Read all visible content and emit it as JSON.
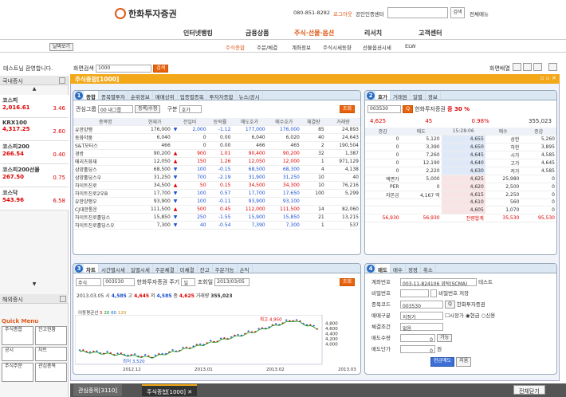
{
  "header": {
    "brand": "한화투자증권",
    "phone": "080-851-8282",
    "login": "로그아웃",
    "cert": "공인인증센터",
    "search_btn": "검색",
    "all_menu": "전체메뉴"
  },
  "nav": [
    "인터넷뱅킹",
    "금융상품",
    "주식·선물·옵션",
    "리서치",
    "고객센터"
  ],
  "subnav": [
    "주식종합",
    "주문/체결",
    "계좌정보",
    "주식시세동향",
    "선물옵션시세",
    "ELW"
  ],
  "datefilter": "날짜보기",
  "welcome": "테스트님 환영합니다.",
  "screen_search": {
    "label": "화면검색",
    "value": "1000",
    "button": "검색",
    "layout_label": "화면배열"
  },
  "left": {
    "domestic_title": "국내증시",
    "indices": [
      {
        "name": "코스피",
        "value": "2,016.61",
        "change": "3.46"
      },
      {
        "name": "KRX100",
        "value": "4,317.25",
        "change": "2.60"
      },
      {
        "name": "코스피200",
        "value": "266.54",
        "change": "0.40"
      },
      {
        "name": "코스피200선물",
        "value": "267.50",
        "change": "0.75"
      },
      {
        "name": "코스닥",
        "value": "543.96",
        "change": "6.58"
      }
    ],
    "overseas_title": "해외증시",
    "quick_title": "Quick Menu",
    "quick": [
      "주식종합",
      "잔고현황",
      "공시",
      "차트",
      "주식주문",
      "관심종목"
    ]
  },
  "main_title": "주식종합[1000]",
  "p1": {
    "tabs": [
      "종합",
      "종목별투자",
      "순위정보",
      "매매상위",
      "업종별종목",
      "투자자종합",
      "뉴스/공시"
    ],
    "group_label": "관심그룹",
    "group_value": "00 내그룹",
    "reg_btn": "등록/수정",
    "div_label": "구분",
    "div_value": "호가",
    "query": "조회",
    "cols": [
      "종목명",
      "현재가",
      "전일비",
      "등락률",
      "매도호가",
      "매수호가",
      "체결량",
      "거래량"
    ],
    "rows": [
      [
        "유한양행",
        "176,000",
        "▼",
        "2,000",
        "-1.12",
        "177,000",
        "176,000",
        "85",
        "24,893"
      ],
      [
        "동화약품",
        "6,040",
        "",
        "0",
        "0.00",
        "6,040",
        "6,020",
        "40",
        "24,643"
      ],
      [
        "S&T모터스",
        "466",
        "",
        "0",
        "0.00",
        "466",
        "465",
        "2",
        "190,504"
      ],
      [
        "경방",
        "90,200",
        "▲",
        "900",
        "1.01",
        "90,400",
        "90,200",
        "32",
        "1,387"
      ],
      [
        "메리츠화재",
        "12,050",
        "▲",
        "150",
        "1.26",
        "12,050",
        "12,000",
        "1",
        "971,129"
      ],
      [
        "삼양홀딩스",
        "68,500",
        "▼",
        "100",
        "-0.15",
        "68,500",
        "68,300",
        "4",
        "4,138"
      ],
      [
        "삼양홀딩스우",
        "31,250",
        "▼",
        "700",
        "-2.19",
        "31,900",
        "31,250",
        "10",
        "40"
      ],
      [
        "하이트진로",
        "34,500",
        "▲",
        "50",
        "0.15",
        "34,500",
        "34,300",
        "10",
        "76,216"
      ],
      [
        "하이트진로2우B",
        "17,700",
        "▼",
        "100",
        "0.57",
        "17,700",
        "17,650",
        "100",
        "5,299"
      ],
      [
        "유한양행우",
        "93,900",
        "▼",
        "100",
        "-0.11",
        "93,900",
        "93,100",
        "",
        ""
      ],
      [
        "CJ대한통운",
        "111,500",
        "▲",
        "500",
        "0.45",
        "112,000",
        "111,500",
        "14",
        "82,060"
      ],
      [
        "하이트진로홀딩스",
        "15,850",
        "▼",
        "250",
        "-1.55",
        "15,900",
        "15,850",
        "21",
        "13,215"
      ],
      [
        "하이트진로홀딩스우",
        "7,300",
        "▼",
        "40",
        "-0.54",
        "7,390",
        "7,300",
        "1",
        "537"
      ]
    ]
  },
  "p2": {
    "tabs": [
      "호가",
      "거래원",
      "일별",
      "정보"
    ],
    "code": "003530",
    "name": "한화투자증권",
    "margin": "증 30 %",
    "price": "4,625",
    "chg": "45",
    "pct": "0.98%",
    "vol": "355,023",
    "hcols": [
      "증감",
      "매도",
      "15:28:06",
      "매수",
      "증감"
    ],
    "ask": [
      [
        "0",
        "5,120",
        "4,655",
        "상한",
        "5,260"
      ],
      [
        "0",
        "3,390",
        "4,650",
        "하한",
        "3,895"
      ],
      [
        "0",
        "7,260",
        "4,645",
        "시가",
        "4,585"
      ],
      [
        "0",
        "12,190",
        "4,640",
        "고가",
        "4,645"
      ],
      [
        "0",
        "2,220",
        "4,630",
        "저가",
        "4,585"
      ]
    ],
    "bid": [
      [
        "액면가",
        "5,000",
        "4,625",
        "25,980",
        "0"
      ],
      [
        "PER",
        "0",
        "4,620",
        "2,500",
        "0"
      ],
      [
        "자본금",
        "4,167 억",
        "4,615",
        "2,250",
        "0"
      ],
      [
        "",
        "",
        "4,610",
        "560",
        "0"
      ],
      [
        "",
        "",
        "4,605",
        "1,070",
        "0"
      ]
    ],
    "foot": [
      "56,930",
      "56,930",
      "잔량합계",
      "35,530",
      "95,530"
    ]
  },
  "p3": {
    "tabs": [
      "차트",
      "시간별시세",
      "일별시세",
      "주문체결",
      "미체결",
      "잔고",
      "주문가능",
      "손익"
    ],
    "market": "주식",
    "code": "003530",
    "name": "한화투자증권",
    "period_label": "주기",
    "period": "일",
    "query_label": "조회일",
    "date": "2013/03/05",
    "query": "조회",
    "info": {
      "date": "2013.03.05",
      "open_l": "시",
      "open": "4,585",
      "high_l": "고",
      "high": "4,645",
      "low_l": "저",
      "low": "4,585",
      "close_l": "종",
      "close": "4,625",
      "vol_l": "거래량",
      "vol": "355,023"
    },
    "legend": "이동평균선",
    "ma": [
      "5",
      "20",
      "60",
      "120"
    ],
    "max_label": "최고 4,950",
    "min_label": "최저 3,520",
    "yt": [
      "4,800",
      "4,600",
      "4,400",
      "4,200",
      "4,000"
    ],
    "xt": [
      "2012.12",
      "2013.01",
      "2013.02",
      "2013.03"
    ]
  },
  "chart_data": {
    "type": "candlestick",
    "ylim": [
      3400,
      5000
    ],
    "max": 4950,
    "min": 3520,
    "x": [
      "2012.12",
      "2013.01",
      "2013.02",
      "2013.03"
    ]
  },
  "p4": {
    "tabs": [
      "매도",
      "매수",
      "정정",
      "취소"
    ],
    "account_label": "계좌번호",
    "account": "003-11-824106 위탁(SCMA)",
    "account_name": "테스트",
    "pw_label": "비밀번호",
    "pw_save": "비밀번호 저장",
    "code_label": "종목코드",
    "code": "003530",
    "code_name": "한화투자증권",
    "type_label": "매매구분",
    "type": "지정가",
    "mkt": "시장가",
    "cash": "현금",
    "credit": "신용",
    "cond_label": "체결조건",
    "cond": "없음",
    "qty_label": "매도수량",
    "qty": "0",
    "qty_btn": "가능",
    "price_label": "매도단가",
    "price": "0",
    "unit": "원",
    "sell_btn": "현금매도",
    "new_btn": "지움"
  },
  "bottom": {
    "tabs": [
      "관심종목[3110]",
      "주식종합[1000]"
    ],
    "close_all": "전체닫기"
  }
}
